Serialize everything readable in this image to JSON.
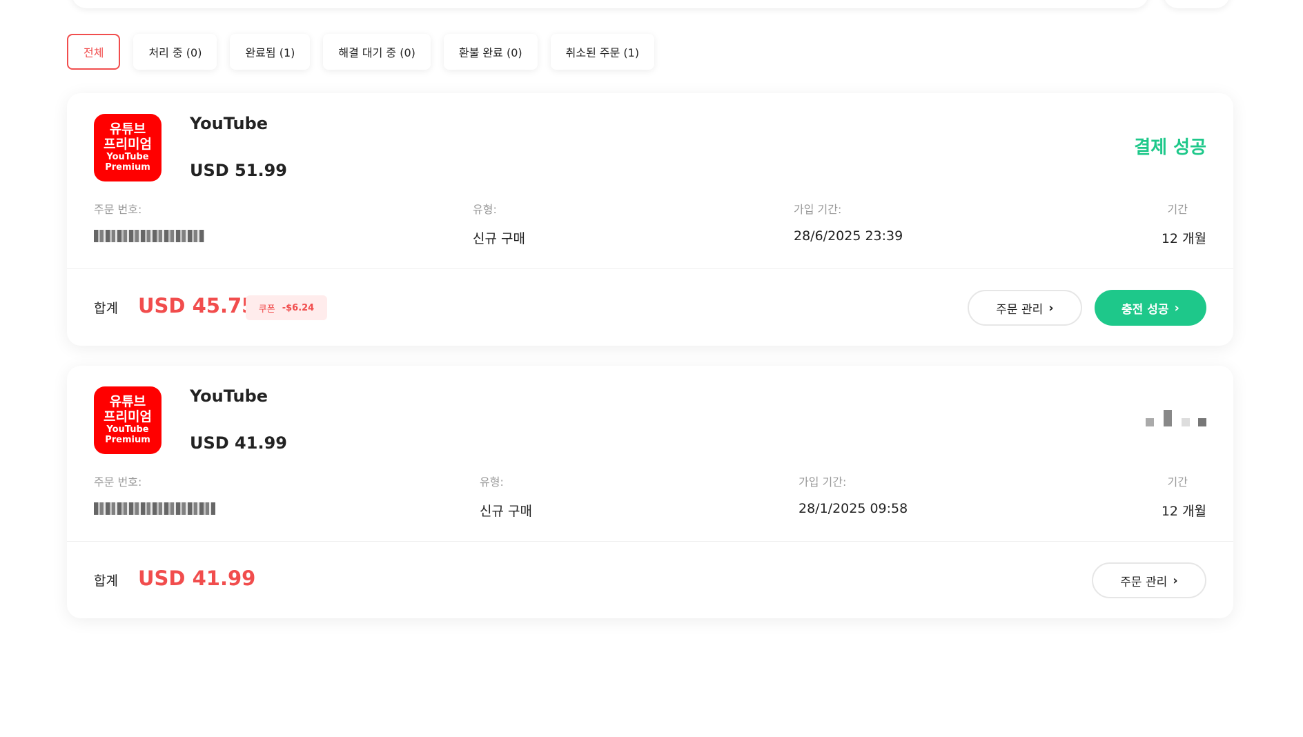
{
  "tabs": [
    {
      "label": "전체",
      "active": true
    },
    {
      "label": "처리 중 (0)"
    },
    {
      "label": "완료됨 (1)"
    },
    {
      "label": "해결 대기 중 (0)"
    },
    {
      "label": "환불 완료 (0)"
    },
    {
      "label": "취소된 주문 (1)"
    }
  ],
  "orders": [
    {
      "logo_ko_line1": "유튜브",
      "logo_ko_line2": "프리미엄",
      "logo_en_line1": "YouTube",
      "logo_en_line2": "Premium",
      "product": "YouTube",
      "price": "USD 51.99",
      "status": "결제 성공",
      "order_no_label": "주문 번호:",
      "type_label": "유형:",
      "type_value": "신규 구매",
      "date_label": "가입 기간:",
      "date_value": "28/6/2025 23:39",
      "period_label": "기간",
      "period_value": "12 개월",
      "total_label": "합계",
      "total": "USD 45.75",
      "coupon_label": "쿠폰",
      "coupon_amount": "-$6.24",
      "manage_label": "주문 관리",
      "charge_label": "충전 성공"
    },
    {
      "logo_ko_line1": "유튜브",
      "logo_ko_line2": "프리미엄",
      "logo_en_line1": "YouTube",
      "logo_en_line2": "Premium",
      "product": "YouTube",
      "price": "USD 41.99",
      "order_no_label": "주문 번호:",
      "type_label": "유형:",
      "type_value": "신규 구매",
      "date_label": "가입 기간:",
      "date_value": "28/1/2025 09:58",
      "period_label": "기간",
      "period_value": "12 개월",
      "total_label": "합계",
      "total": "USD 41.99",
      "manage_label": "주문 관리"
    }
  ],
  "colors": {
    "accent_red": "#f14d4d",
    "success_green": "#1ec88a",
    "logo_red": "#ff0000"
  },
  "icons": {
    "chevron": "chevron-right-icon",
    "status_loading": "loading-dots-icon"
  }
}
